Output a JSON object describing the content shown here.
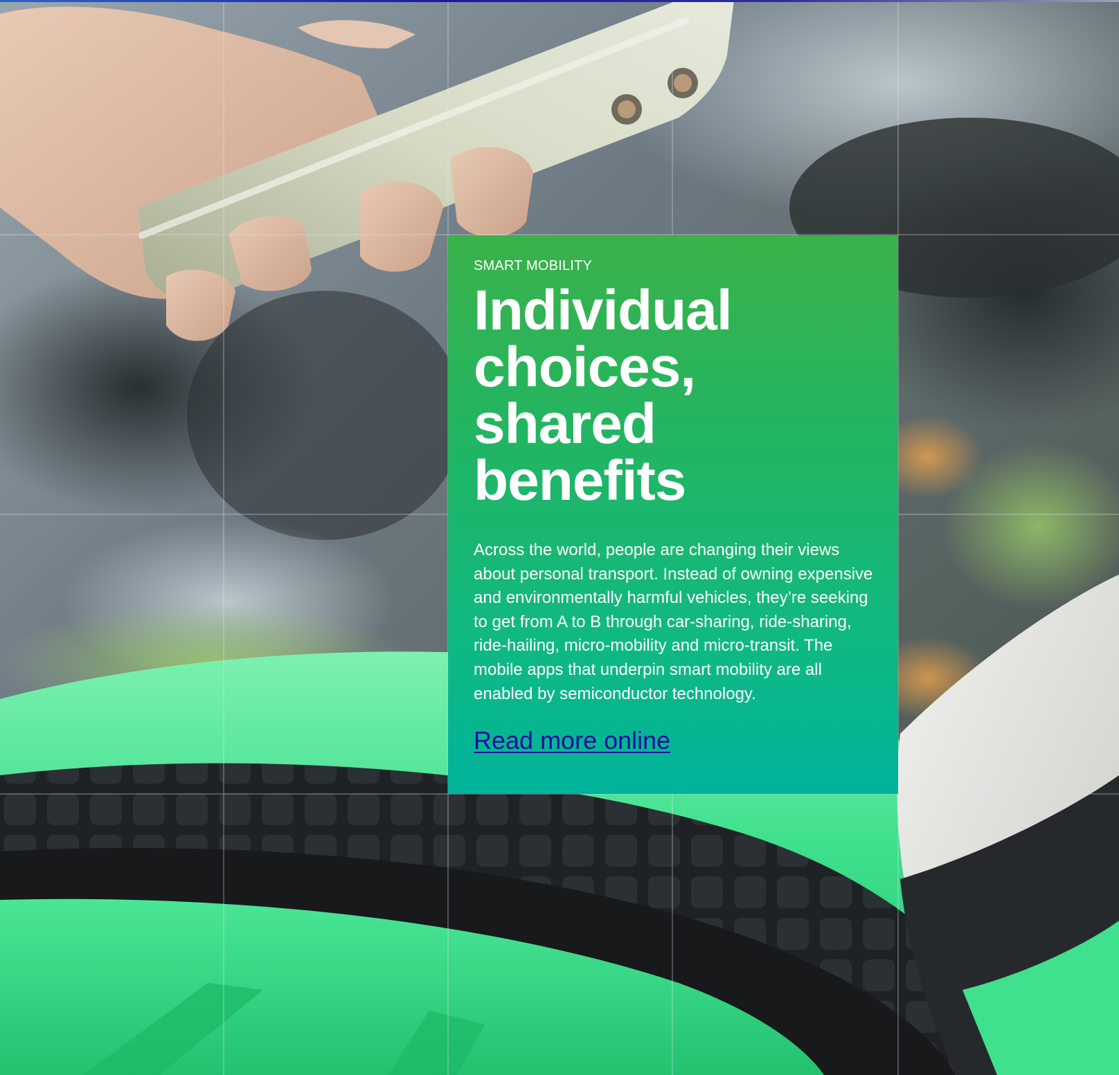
{
  "colors": {
    "card_gradient_top": "#3ab24a",
    "card_gradient_bottom": "#00b39c",
    "card_text": "#ffffff",
    "link": "#1a0ea0",
    "bike_green": "#2fdc86",
    "tire": "#1b1f22",
    "phone": "#cfd3bf"
  },
  "story": {
    "kicker": "SMART MOBILITY",
    "title_lines": [
      "Individual",
      "choices,",
      "shared",
      "benefits"
    ],
    "body": "Across the world, people are changing their views about personal transport. Instead of owning expensive and environmentally harmful vehicles, they’re seeking to get from A to B through car-sharing, ride-sharing, ride-hailing, micro-mobility and micro-transit. The mobile apps that underpin smart mobility are all enabled by semiconductor technology.",
    "link_label": "Read more online"
  },
  "photo": {
    "subject": "hand holding smartphone over green shared bike wheel",
    "icon": "photo-icon"
  }
}
